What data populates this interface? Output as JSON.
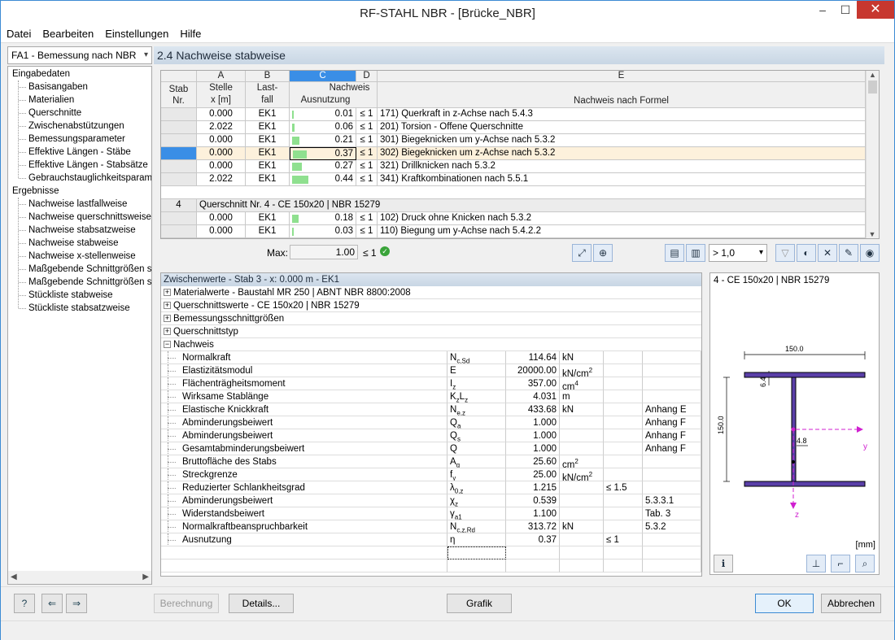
{
  "app": {
    "title": "RF-STAHL NBR - [Brücke_NBR]",
    "minimize": "–",
    "maximize": "☐",
    "close": "✕"
  },
  "menu": [
    "Datei",
    "Bearbeiten",
    "Einstellungen",
    "Hilfe"
  ],
  "case_select": "FA1 - Bemessung nach NBR",
  "nav": {
    "input_group": "Eingabedaten",
    "input_items": [
      "Basisangaben",
      "Materialien",
      "Querschnitte",
      "Zwischenabstützungen",
      "Bemessungsparameter",
      "Effektive Längen - Stäbe",
      "Effektive Längen - Stabsätze",
      "Gebrauchstauglichkeitsparameter"
    ],
    "results_group": "Ergebnisse",
    "results_items": [
      "Nachweise lastfallweise",
      "Nachweise querschnittsweise",
      "Nachweise stabsatzweise",
      "Nachweise stabweise",
      "Nachweise x-stellenweise",
      "Maßgebende Schnittgrößen stabweise",
      "Maßgebende Schnittgrößen stabsatzweise",
      "Stückliste stabweise",
      "Stückliste stabsatzweise"
    ]
  },
  "section_title": "2.4 Nachweise stabweise",
  "grid": {
    "col_letters": [
      "A",
      "B",
      "C",
      "D",
      "E"
    ],
    "hdr_stab": [
      "Stab",
      "Nr."
    ],
    "hdr_a": [
      "Stelle",
      "x [m]"
    ],
    "hdr_b": [
      "Last-",
      "fall"
    ],
    "hdr_c": [
      "Nachweis",
      "Ausnutzung"
    ],
    "hdr_e": "Nachweis nach Formel",
    "rows": [
      {
        "stab": "",
        "x": "0.000",
        "lf": "EK1",
        "ratio": 0.01,
        "ratio_text": "0.01",
        "le": "≤ 1",
        "formel": "171) Querkraft in z-Achse nach 5.4.3"
      },
      {
        "stab": "",
        "x": "2.022",
        "lf": "EK1",
        "ratio": 0.06,
        "ratio_text": "0.06",
        "le": "≤ 1",
        "formel": "201) Torsion - Offene Querschnitte"
      },
      {
        "stab": "",
        "x": "0.000",
        "lf": "EK1",
        "ratio": 0.21,
        "ratio_text": "0.21",
        "le": "≤ 1",
        "formel": "301) Biegeknicken um y-Achse nach 5.3.2"
      },
      {
        "stab": "",
        "x": "0.000",
        "lf": "EK1",
        "ratio": 0.37,
        "ratio_text": "0.37",
        "le": "≤ 1",
        "formel": "302) Biegeknicken um z-Achse nach 5.3.2"
      },
      {
        "stab": "",
        "x": "0.000",
        "lf": "EK1",
        "ratio": 0.27,
        "ratio_text": "0.27",
        "le": "≤ 1",
        "formel": "321) Drillknicken nach 5.3.2"
      },
      {
        "stab": "",
        "x": "2.022",
        "lf": "EK1",
        "ratio": 0.44,
        "ratio_text": "0.44",
        "le": "≤ 1",
        "formel": "341) Kraftkombinationen nach 5.5.1"
      }
    ],
    "group_row": {
      "stab": "4",
      "text": "Querschnitt Nr.  4 - CE 150x20 | NBR 15279"
    },
    "rows2": [
      {
        "stab": "",
        "x": "0.000",
        "lf": "EK1",
        "ratio": 0.18,
        "ratio_text": "0.18",
        "le": "≤ 1",
        "formel": "102) Druck ohne Knicken nach 5.3.2"
      },
      {
        "stab": "",
        "x": "0.000",
        "lf": "EK1",
        "ratio": 0.03,
        "ratio_text": "0.03",
        "le": "≤ 1",
        "formel": "110) Biegung um y-Achse nach 5.4.2.2"
      }
    ]
  },
  "max": {
    "label": "Max:",
    "value": "1.00",
    "le": "≤ 1"
  },
  "filter_select": "> 1,0",
  "detail": {
    "title": "Zwischenwerte - Stab 3 - x: 0.000 m - EK1",
    "groups": [
      "Materialwerte - Baustahl MR 250 | ABNT NBR 8800:2008",
      "Querschnittswerte  - CE 150x20 | NBR 15279",
      "Bemessungsschnittgrößen",
      "Querschnittstyp",
      "Nachweis"
    ],
    "rows": [
      {
        "name": "Normalkraft",
        "sym": "Nc,Sd",
        "val": "114.64",
        "unit": "kN",
        "lim": "",
        "ref": ""
      },
      {
        "name": "Elastizitätsmodul",
        "sym": "E",
        "val": "20000.00",
        "unit": "kN/cm2",
        "lim": "",
        "ref": ""
      },
      {
        "name": "Flächenträgheitsmoment",
        "sym": "Iz",
        "val": "357.00",
        "unit": "cm4",
        "lim": "",
        "ref": ""
      },
      {
        "name": "Wirksame Stablänge",
        "sym": "KzLz",
        "val": "4.031",
        "unit": "m",
        "lim": "",
        "ref": ""
      },
      {
        "name": "Elastische Knickkraft",
        "sym": "Ne,z",
        "val": "433.68",
        "unit": "kN",
        "lim": "",
        "ref": "Anhang E"
      },
      {
        "name": "Abminderungsbeiwert",
        "sym": "Qa",
        "val": "1.000",
        "unit": "",
        "lim": "",
        "ref": "Anhang F"
      },
      {
        "name": "Abminderungsbeiwert",
        "sym": "Qs",
        "val": "1.000",
        "unit": "",
        "lim": "",
        "ref": "Anhang F"
      },
      {
        "name": "Gesamtabminderungsbeiwert",
        "sym": "Q",
        "val": "1.000",
        "unit": "",
        "lim": "",
        "ref": "Anhang F"
      },
      {
        "name": "Bruttofläche des Stabs",
        "sym": "Ag",
        "val": "25.60",
        "unit": "cm2",
        "lim": "",
        "ref": ""
      },
      {
        "name": "Streckgrenze",
        "sym": "fy",
        "val": "25.00",
        "unit": "kN/cm2",
        "lim": "",
        "ref": ""
      },
      {
        "name": "Reduzierter Schlankheitsgrad",
        "sym": "λ0,z",
        "val": "1.215",
        "unit": "",
        "lim": "≤ 1.5",
        "ref": ""
      },
      {
        "name": "Abminderungsbeiwert",
        "sym": "χz",
        "val": "0.539",
        "unit": "",
        "lim": "",
        "ref": "5.3.3.1"
      },
      {
        "name": "Widerstandsbeiwert",
        "sym": "γa1",
        "val": "1.100",
        "unit": "",
        "lim": "",
        "ref": "Tab. 3"
      },
      {
        "name": "Normalkraftbeanspruchbarkeit",
        "sym": "Nc,z,Rd",
        "val": "313.72",
        "unit": "kN",
        "lim": "",
        "ref": "5.3.2"
      },
      {
        "name": "Ausnutzung",
        "sym": "η",
        "val": "0.37",
        "unit": "",
        "lim": "≤ 1",
        "ref": ""
      }
    ]
  },
  "preview": {
    "title": "4 - CE 150x20 | NBR 15279",
    "dim_width": "150.0",
    "dim_height": "150.0",
    "dim_flange": "6.4",
    "dim_web": "4.8",
    "axis_y": "y",
    "axis_z": "z",
    "unit": "[mm]"
  },
  "buttons": {
    "berechnung": "Berechnung",
    "details": "Details...",
    "grafik": "Grafik",
    "ok": "OK",
    "abbrechen": "Abbrechen"
  }
}
